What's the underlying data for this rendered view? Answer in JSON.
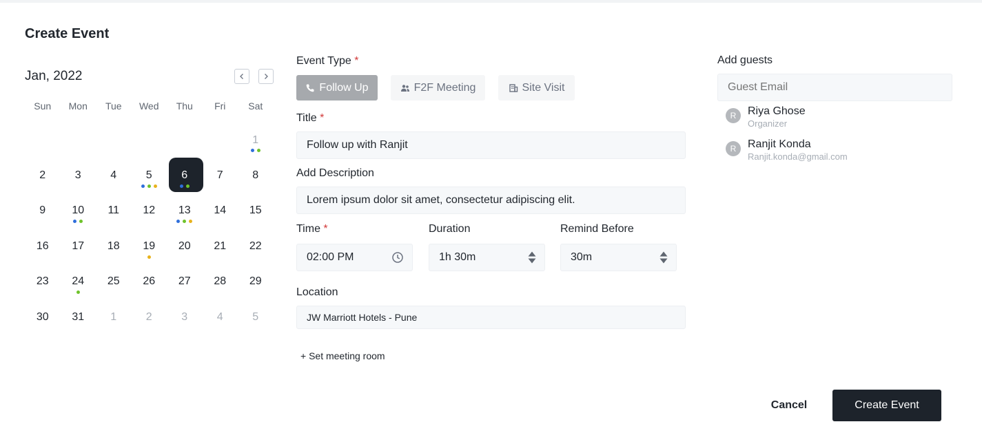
{
  "page": {
    "title": "Create Event"
  },
  "calendar": {
    "month_label": "Jan, 2022",
    "weekdays": [
      "Sun",
      "Mon",
      "Tue",
      "Wed",
      "Thu",
      "Fri",
      "Sat"
    ],
    "selected_day": "6",
    "days": [
      {
        "d": "",
        "muted": false,
        "dots": []
      },
      {
        "d": "",
        "muted": false,
        "dots": []
      },
      {
        "d": "",
        "muted": false,
        "dots": []
      },
      {
        "d": "",
        "muted": false,
        "dots": []
      },
      {
        "d": "",
        "muted": false,
        "dots": []
      },
      {
        "d": "",
        "muted": false,
        "dots": []
      },
      {
        "d": "1",
        "muted": true,
        "dots": [
          "#2f6fdb",
          "#6fc32b"
        ]
      },
      {
        "d": "2",
        "muted": false,
        "dots": []
      },
      {
        "d": "3",
        "muted": false,
        "dots": []
      },
      {
        "d": "4",
        "muted": false,
        "dots": []
      },
      {
        "d": "5",
        "muted": false,
        "dots": [
          "#2f6fdb",
          "#6fc32b",
          "#e8b21c"
        ]
      },
      {
        "d": "6",
        "muted": false,
        "dots": [
          "#2f6fdb",
          "#6fc32b"
        ]
      },
      {
        "d": "7",
        "muted": false,
        "dots": []
      },
      {
        "d": "8",
        "muted": false,
        "dots": []
      },
      {
        "d": "9",
        "muted": false,
        "dots": []
      },
      {
        "d": "10",
        "muted": false,
        "dots": [
          "#2f6fdb",
          "#6fc32b"
        ]
      },
      {
        "d": "11",
        "muted": false,
        "dots": []
      },
      {
        "d": "12",
        "muted": false,
        "dots": []
      },
      {
        "d": "13",
        "muted": false,
        "dots": [
          "#2f6fdb",
          "#6fc32b",
          "#e8b21c"
        ]
      },
      {
        "d": "14",
        "muted": false,
        "dots": []
      },
      {
        "d": "15",
        "muted": false,
        "dots": []
      },
      {
        "d": "16",
        "muted": false,
        "dots": []
      },
      {
        "d": "17",
        "muted": false,
        "dots": []
      },
      {
        "d": "18",
        "muted": false,
        "dots": []
      },
      {
        "d": "19",
        "muted": false,
        "dots": [
          "#e8b21c"
        ]
      },
      {
        "d": "20",
        "muted": false,
        "dots": []
      },
      {
        "d": "21",
        "muted": false,
        "dots": []
      },
      {
        "d": "22",
        "muted": false,
        "dots": []
      },
      {
        "d": "23",
        "muted": false,
        "dots": []
      },
      {
        "d": "24",
        "muted": false,
        "dots": [
          "#6fc32b"
        ]
      },
      {
        "d": "25",
        "muted": false,
        "dots": []
      },
      {
        "d": "26",
        "muted": false,
        "dots": []
      },
      {
        "d": "27",
        "muted": false,
        "dots": []
      },
      {
        "d": "28",
        "muted": false,
        "dots": []
      },
      {
        "d": "29",
        "muted": false,
        "dots": []
      },
      {
        "d": "30",
        "muted": false,
        "dots": []
      },
      {
        "d": "31",
        "muted": false,
        "dots": []
      },
      {
        "d": "1",
        "muted": true,
        "dots": []
      },
      {
        "d": "2",
        "muted": true,
        "dots": []
      },
      {
        "d": "3",
        "muted": true,
        "dots": []
      },
      {
        "d": "4",
        "muted": true,
        "dots": []
      },
      {
        "d": "5",
        "muted": true,
        "dots": []
      }
    ]
  },
  "form": {
    "event_type_label": "Event Type",
    "required_mark": "*",
    "event_types": [
      {
        "label": "Follow Up",
        "icon": "phone-icon",
        "active": true
      },
      {
        "label": "F2F Meeting",
        "icon": "people-icon",
        "active": false
      },
      {
        "label": "Site Visit",
        "icon": "building-icon",
        "active": false
      }
    ],
    "title_label": "Title",
    "title_value": "Follow up with Ranjit",
    "description_label": "Add Description",
    "description_value": "Lorem ipsum dolor sit amet, consectetur adipiscing elit.",
    "time_label": "Time",
    "time_value": "02:00 PM",
    "duration_label": "Duration",
    "duration_value": "1h 30m",
    "remind_label": "Remind Before",
    "remind_value": "30m",
    "location_label": "Location",
    "location_value": "JW Marriott Hotels - Pune",
    "meeting_room_link": "+ Set meeting room"
  },
  "guests": {
    "label": "Add guests",
    "placeholder": "Guest Email",
    "list": [
      {
        "initial": "R",
        "name": "Riya Ghose",
        "sub": "Organizer"
      },
      {
        "initial": "R",
        "name": "Ranjit Konda",
        "sub": "Ranjit.konda@gmail.com"
      }
    ]
  },
  "actions": {
    "cancel": "Cancel",
    "create": "Create Event"
  }
}
